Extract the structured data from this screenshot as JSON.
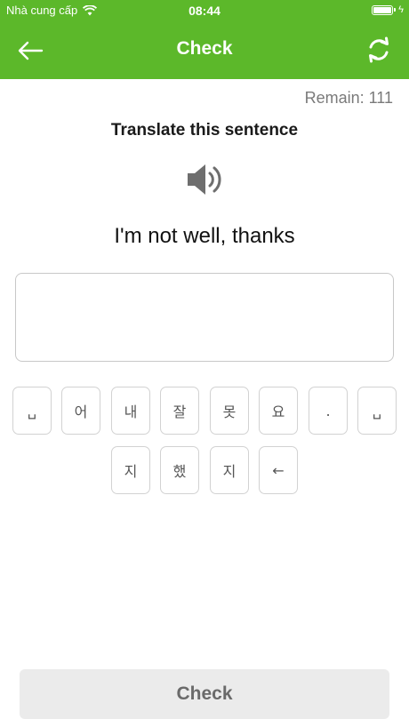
{
  "status_bar": {
    "carrier": "Nhà cung cấp",
    "time": "08:44",
    "battery_level": 1.0
  },
  "nav": {
    "title": "Check",
    "back_icon": "arrow-left-icon",
    "refresh_icon": "refresh-icon"
  },
  "remain_text": "Remain: 111",
  "instruction": "Translate this sentence",
  "speaker_icon": "speaker-icon",
  "sentence": "I'm not well, thanks",
  "answer": {
    "value": ""
  },
  "keys_row1": [
    "␣",
    "어",
    "내",
    "잘",
    "못",
    "요",
    ".",
    "␣"
  ],
  "keys_row2": [
    "지",
    "했",
    "지",
    "←"
  ],
  "check_button": "Check",
  "colors": {
    "brand_green": "#5cb82a",
    "button_gray": "#ebebeb"
  }
}
